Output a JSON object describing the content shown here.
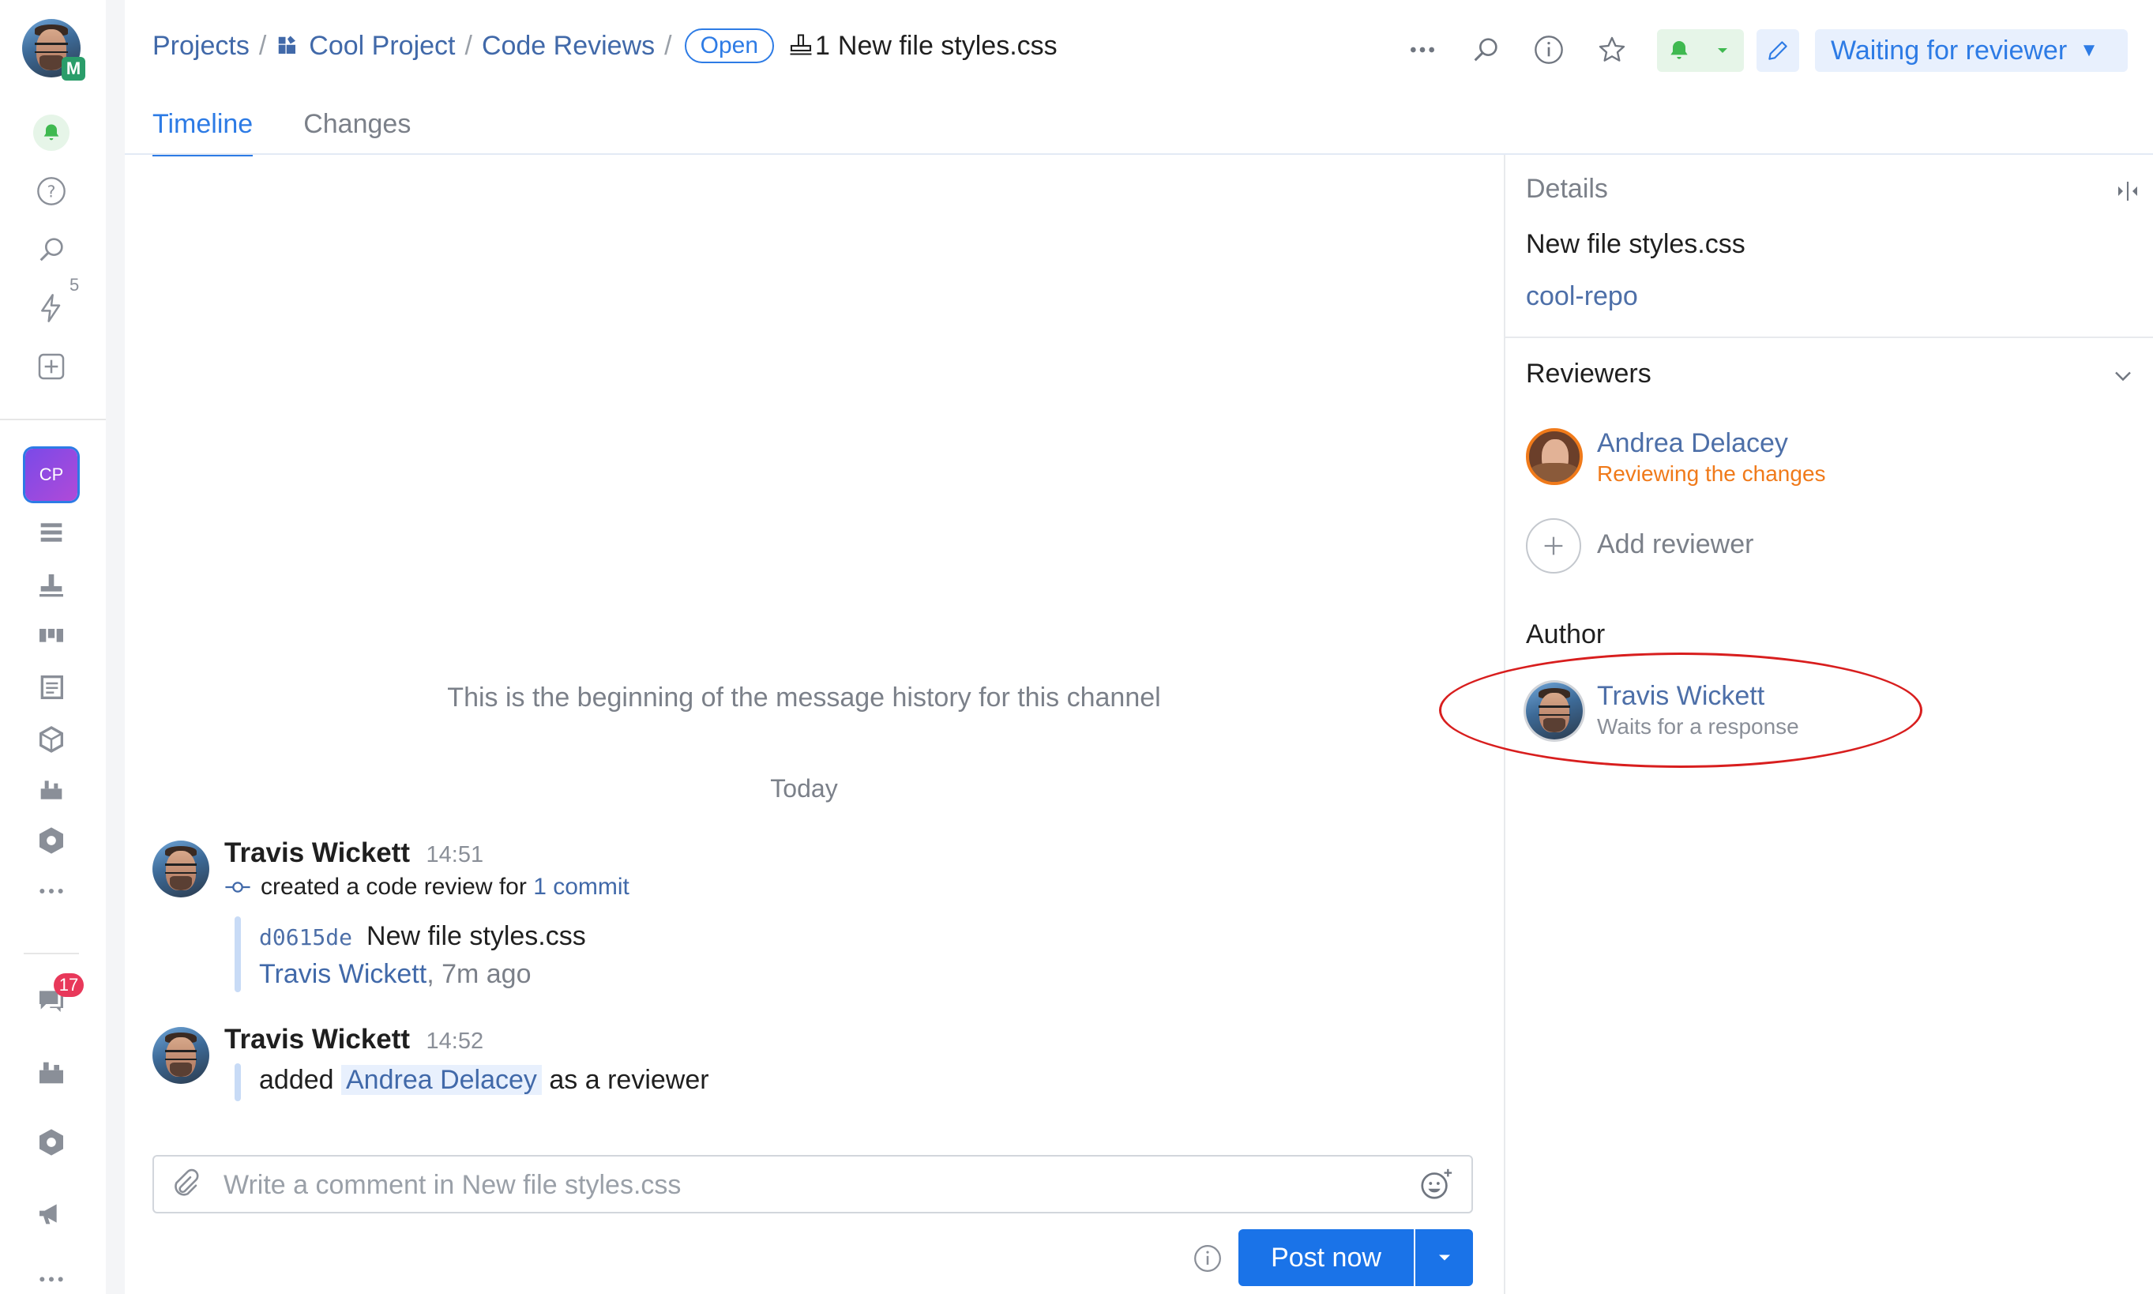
{
  "rail": {
    "notification_count": "5",
    "project_badge": "CP",
    "chats_count": "17"
  },
  "header": {
    "breadcrumb": [
      "Projects",
      "Cool Project",
      "Code Reviews"
    ],
    "status_badge": "Open",
    "review_number": "1",
    "review_title": "New file styles.css",
    "status_dropdown": "Waiting for reviewer"
  },
  "tabs": [
    {
      "label": "Timeline",
      "active": true
    },
    {
      "label": "Changes",
      "active": false
    }
  ],
  "timeline": {
    "beginning_text": "This is the beginning of the message history for this channel",
    "day_label": "Today",
    "messages": [
      {
        "author": "Travis Wickett",
        "time": "14:51",
        "action_prefix": "created a code review for",
        "action_link": "1 commit",
        "commit": {
          "hash": "d0615de",
          "message": "New file styles.css",
          "author": "Travis Wickett",
          "age": ", 7m ago"
        }
      },
      {
        "author": "Travis Wickett",
        "time": "14:52",
        "text_before": "added",
        "mention": "Andrea Delacey",
        "text_after": "as a reviewer"
      }
    ]
  },
  "composer": {
    "placeholder": "Write a comment in New file styles.css",
    "post_label": "Post now"
  },
  "details": {
    "heading": "Details",
    "title": "New file styles.css",
    "repo": "cool-repo",
    "reviewers_heading": "Reviewers",
    "reviewers": [
      {
        "name": "Andrea Delacey",
        "status": "Reviewing the changes",
        "status_color": "#f07a1a"
      }
    ],
    "add_reviewer_label": "Add reviewer",
    "author_heading": "Author",
    "author": {
      "name": "Travis Wickett",
      "status": "Waits for a response"
    }
  },
  "colors": {
    "accent": "#2d7be5",
    "link": "#4169a9",
    "annotation": "#d81e1e",
    "project_badge": "#7a4ae8",
    "notification_green": "#3fb950"
  }
}
